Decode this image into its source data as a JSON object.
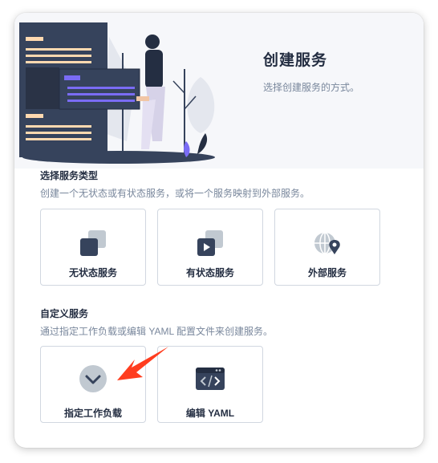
{
  "banner": {
    "title": "创建服务",
    "description": "选择创建服务的方式。"
  },
  "service_type": {
    "title": "选择服务类型",
    "description": "创建一个无状态或有状态服务，或将一个服务映射到外部服务。",
    "options": [
      {
        "label": "无状态服务",
        "icon": "stateless-service-icon"
      },
      {
        "label": "有状态服务",
        "icon": "stateful-service-icon"
      },
      {
        "label": "外部服务",
        "icon": "external-service-icon"
      }
    ]
  },
  "custom_service": {
    "title": "自定义服务",
    "description": "通过指定工作负载或编辑 YAML 配置文件来创建服务。",
    "options": [
      {
        "label": "指定工作负载",
        "icon": "chevron-down-icon"
      },
      {
        "label": "编辑 YAML",
        "icon": "code-editor-icon"
      }
    ]
  },
  "colors": {
    "accent_dark": "#36435c",
    "arrow_red": "#ff3d1f",
    "banner_bg": "#f6f7fa"
  }
}
